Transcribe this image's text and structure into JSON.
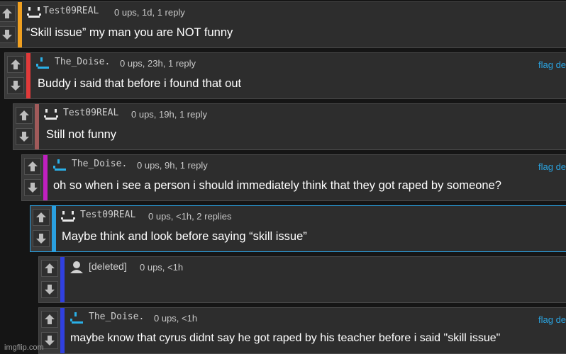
{
  "comments": [
    {
      "username": "Test09REAL",
      "meta": "0 ups, 1d, 1 reply",
      "text": "“Skill issue” my man you are NOT funny",
      "flag": "",
      "bar_color": "#f0a020",
      "avatar": "grin"
    },
    {
      "username": "The_Doise.",
      "meta": "0 ups, 23h, 1 reply",
      "text": "Buddy i said that before i found that out",
      "flag": "flag de",
      "bar_color": "#e03a3a",
      "avatar": "cyan"
    },
    {
      "username": "Test09REAL",
      "meta": "0 ups, 19h, 1 reply",
      "text": "Still not funny",
      "flag": "",
      "bar_color": "#a05a5a",
      "avatar": "grin"
    },
    {
      "username": "The_Doise.",
      "meta": "0 ups, 9h, 1 reply",
      "text": "oh so when i see a person i should immediately think that they got raped by someone?",
      "flag": "flag de",
      "bar_color": "#c020c0",
      "avatar": "cyan"
    },
    {
      "username": "Test09REAL",
      "meta": "0 ups, <1h, 2 replies",
      "text": "Maybe think and look before saying “skill issue”",
      "flag": "",
      "bar_color": "#2aa0e0",
      "avatar": "grin"
    },
    {
      "username": "[deleted]",
      "meta": "0 ups, <1h",
      "text": "",
      "flag": "",
      "bar_color": "#3040e0",
      "avatar": "person"
    },
    {
      "username": "The_Doise.",
      "meta": "0 ups, <1h",
      "text": "maybe know that cyrus didnt say he got raped by his teacher before i said \"skill issue\"",
      "flag": "flag de",
      "bar_color": "#3040e0",
      "avatar": "cyan"
    }
  ],
  "watermark": "imgflip.com"
}
